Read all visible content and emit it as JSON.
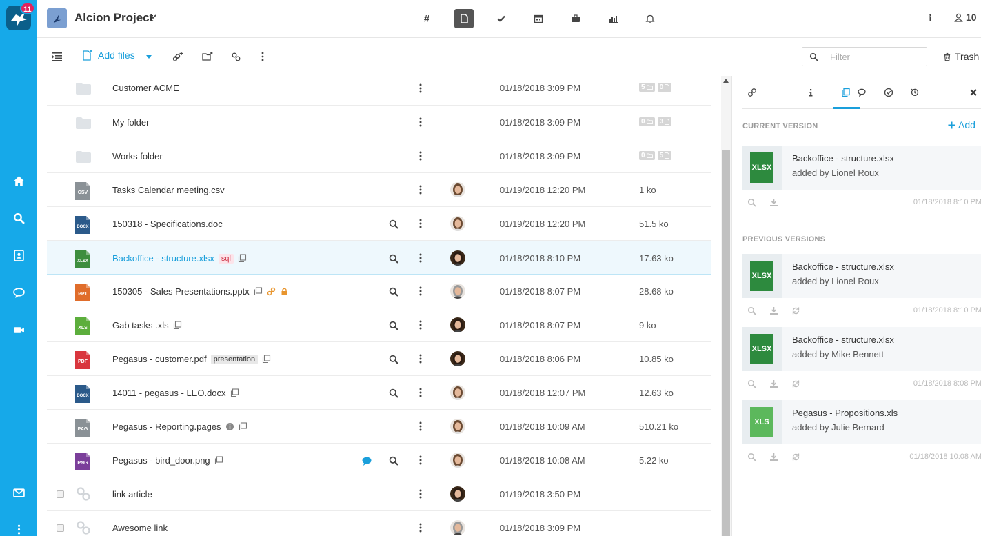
{
  "sidebar": {
    "notification_count": "11",
    "items": [
      {
        "name": "home-icon"
      },
      {
        "name": "search-icon"
      },
      {
        "name": "contacts-icon"
      },
      {
        "name": "chat-icon"
      },
      {
        "name": "video-icon"
      },
      {
        "name": "mail-icon"
      },
      {
        "name": "more-icon"
      }
    ]
  },
  "header": {
    "project_title": "Alcion Project",
    "nav": [
      {
        "label": "#",
        "name": "hashtag"
      },
      {
        "name": "files-icon",
        "active": true
      },
      {
        "name": "tasks-icon"
      },
      {
        "name": "calendar-icon"
      },
      {
        "name": "briefcase-icon"
      },
      {
        "name": "stats-icon"
      },
      {
        "name": "bell-icon"
      }
    ],
    "info_label": "i",
    "member_count": "10"
  },
  "toolbar": {
    "add_files_label": "Add files",
    "filter_placeholder": "Filter",
    "trash_label": "Trash"
  },
  "files": [
    {
      "type": "folder",
      "name": "Customer ACME",
      "date": "01/18/2018 3:09 PM",
      "folders": "5",
      "files": "0"
    },
    {
      "type": "folder",
      "name": "My folder",
      "date": "01/18/2018 3:09 PM",
      "folders": "0",
      "files": "3"
    },
    {
      "type": "folder",
      "name": "Works folder",
      "date": "01/18/2018 3:09 PM",
      "folders": "0",
      "files": "5"
    },
    {
      "type": "file",
      "ext": "CSV",
      "name": "Tasks Calendar meeting.csv",
      "date": "01/19/2018 12:20 PM",
      "size": "1 ko"
    },
    {
      "type": "file",
      "ext": "DOCX",
      "name": "150318 - Specifications.doc",
      "date": "01/19/2018 12:20 PM",
      "size": "51.5 ko"
    },
    {
      "type": "file",
      "ext": "XLSX",
      "name": "Backoffice - structure.xlsx",
      "tag": "sql",
      "date": "01/18/2018 8:10 PM",
      "size": "17.63 ko"
    },
    {
      "type": "file",
      "ext": "PPT",
      "name": "150305 - Sales Presentations.pptx",
      "date": "01/18/2018 8:07 PM",
      "size": "28.68 ko"
    },
    {
      "type": "file",
      "ext": "XLS",
      "name": "Gab tasks .xls",
      "date": "01/18/2018 8:07 PM",
      "size": "9 ko"
    },
    {
      "type": "file",
      "ext": "PDF",
      "name": "Pegasus - customer.pdf",
      "tag": "presentation",
      "date": "01/18/2018 8:06 PM",
      "size": "10.85 ko"
    },
    {
      "type": "file",
      "ext": "DOCX",
      "name": "14011 - pegasus - LEO.docx",
      "date": "01/18/2018 12:07 PM",
      "size": "12.63 ko"
    },
    {
      "type": "file",
      "ext": "PAG",
      "name": "Pegasus - Reporting.pages",
      "date": "01/18/2018 10:09 AM",
      "size": "510.21 ko"
    },
    {
      "type": "file",
      "ext": "PNG",
      "name": "Pegasus - bird_door.png",
      "date": "01/18/2018 10:08 AM",
      "size": "5.22 ko"
    },
    {
      "type": "link",
      "name": "link article",
      "date": "01/19/2018 3:50 PM"
    },
    {
      "type": "link",
      "name": "Awesome link",
      "date": "01/18/2018 3:09 PM"
    }
  ],
  "panel": {
    "current_label": "CURRENT VERSION",
    "add_label": "Add",
    "previous_label": "PREVIOUS VERSIONS",
    "current": {
      "thumb": "XLSX",
      "name": "Backoffice - structure.xlsx",
      "by": "added by Lionel Roux",
      "date": "01/18/2018 8:10 PM"
    },
    "previous": [
      {
        "thumb": "XLSX",
        "name": "Backoffice - structure.xlsx",
        "by": "added by Lionel Roux",
        "date": "01/18/2018 8:10 PM"
      },
      {
        "thumb": "XLSX",
        "name": "Backoffice - structure.xlsx",
        "by": "added by Mike Bennett",
        "date": "01/18/2018 8:08 PM"
      },
      {
        "thumb": "XLS",
        "name": "Pegasus - Propositions.xls",
        "by": "added by Julie Bernard",
        "date": "01/18/2018 10:08 AM"
      }
    ]
  },
  "colors": {
    "accent": "#1a9fdb",
    "sidebar": "#16a9e9",
    "badge": "#e0245e"
  }
}
